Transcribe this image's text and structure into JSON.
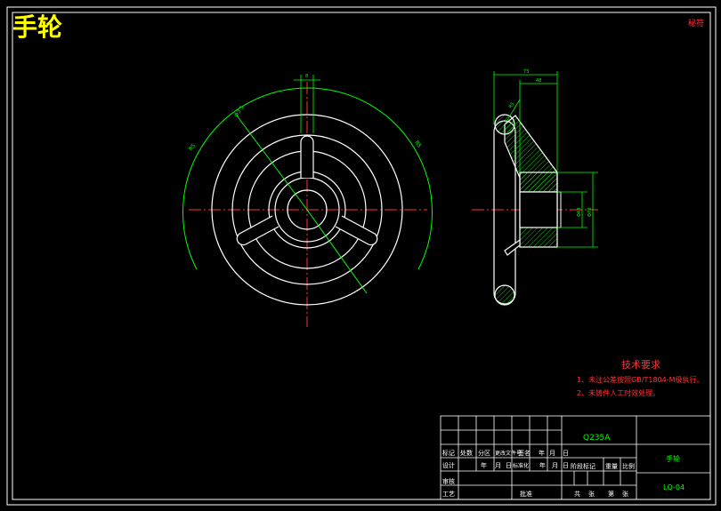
{
  "drawing": {
    "title": "手轮",
    "corner_mark": "秘符",
    "front_view": {
      "dims": {
        "slot_width": "8",
        "dia_outer": "Φ3.5",
        "arc_left": "R5",
        "arc_right": "R5"
      }
    },
    "side_view": {
      "dims": {
        "overall_width": "73",
        "hub_width": "48",
        "hub_bore": "Φ43",
        "hub_od": "Φ78",
        "rim": "R5"
      }
    },
    "tech_requirements": {
      "heading": "技术要求",
      "items": [
        "1、未注公差按照GB/T1804-M级执行。",
        "2、未铸件人工时效处理。"
      ]
    },
    "title_block": {
      "material": "Q235A",
      "part_name": "手轮",
      "drawing_no": "LQ-04",
      "rev_row": [
        "标记",
        "处数",
        "分区",
        "更改文件号",
        "签名",
        "年",
        "月",
        "日"
      ],
      "design_row": [
        "设计",
        "",
        "年",
        "月",
        "日",
        "标准化",
        "",
        "年",
        "月",
        "日"
      ],
      "stage_labels": [
        "阶段标记",
        "重量",
        "比例"
      ],
      "review": "审核",
      "process": "工艺",
      "approve": "批准",
      "sheet": [
        "共",
        "张",
        "第",
        "张"
      ]
    }
  },
  "colors": {
    "background": "#000000",
    "outline": "#ffffff",
    "dimension": "#00ff00",
    "centerline": "#ff0000",
    "hatch": "#00ff00",
    "title_text": "#ffff00",
    "tech_text": "#ff0000"
  }
}
